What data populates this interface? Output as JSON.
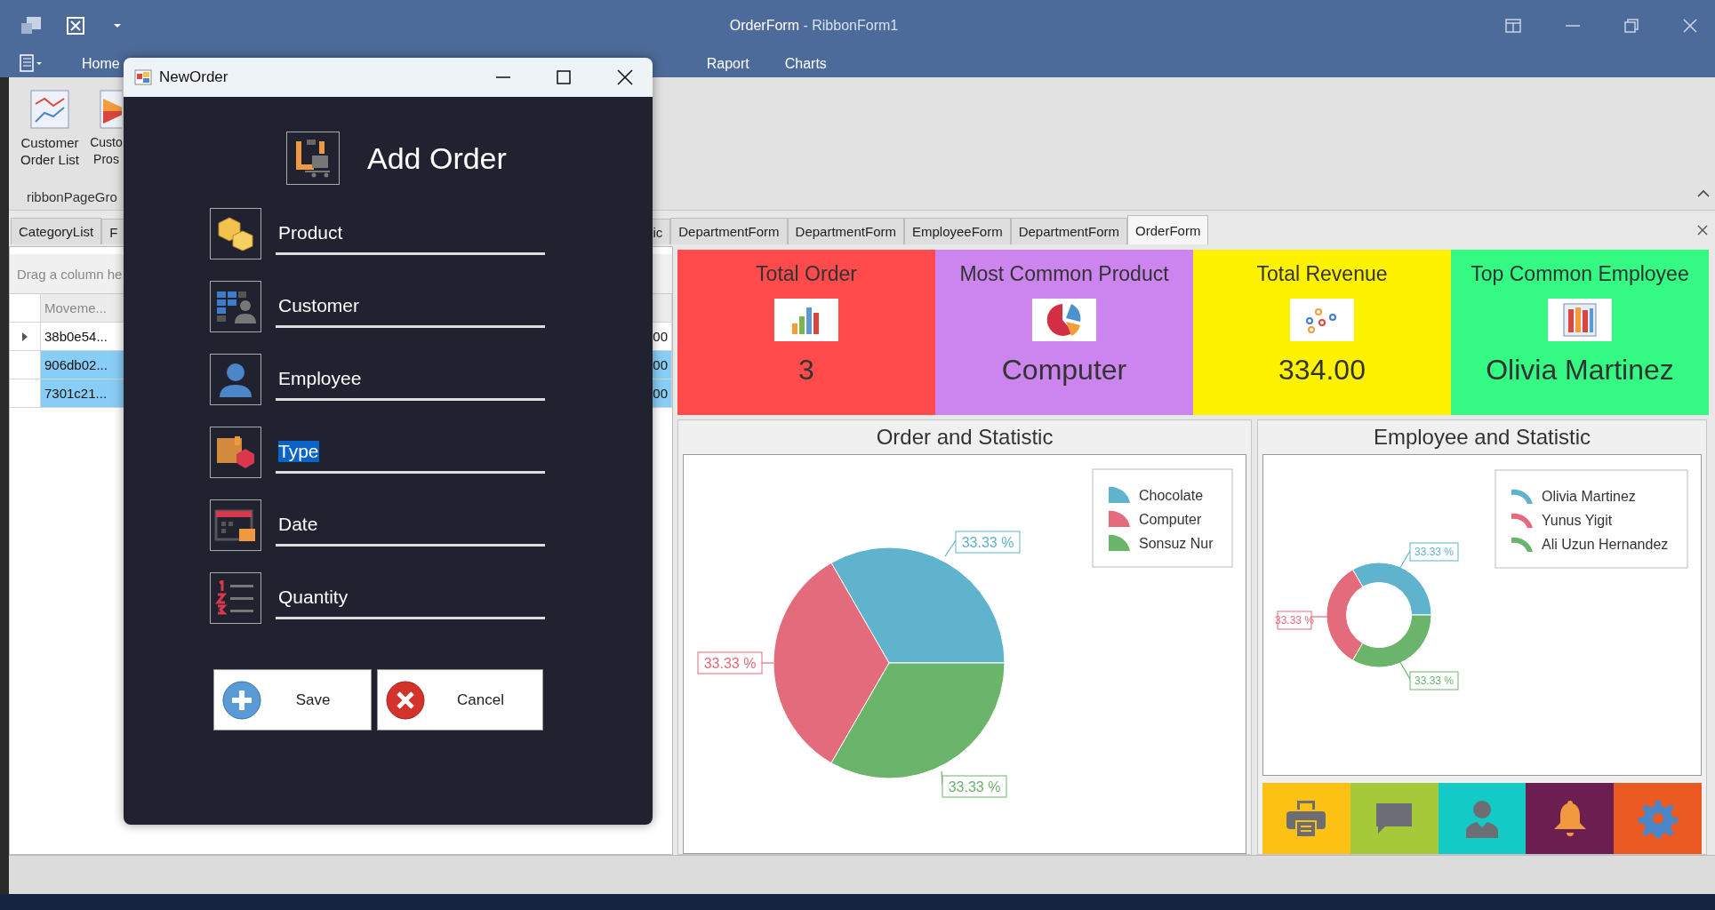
{
  "window": {
    "title": "OrderForm",
    "subtitle": " - RibbonForm1"
  },
  "ribbon": {
    "tabs": [
      {
        "label": "Home",
        "selected": false
      },
      {
        "label": "Raport",
        "selected": false
      },
      {
        "label": "Charts",
        "selected": false
      }
    ],
    "buttons": [
      {
        "label": "Customer Order List"
      },
      {
        "label": "Custo Pros"
      }
    ],
    "group_label": "ribbonPageGro"
  },
  "doc_tabs_left": [
    {
      "label": "CategoryList",
      "selected": false
    },
    {
      "label": "F",
      "selected": false
    }
  ],
  "doc_tabs_right": [
    {
      "label": "ic",
      "selected": false
    },
    {
      "label": "DepartmentForm",
      "selected": false
    },
    {
      "label": "DepartmentForm",
      "selected": false
    },
    {
      "label": "EmployeeForm",
      "selected": false
    },
    {
      "label": "DepartmentForm",
      "selected": false
    },
    {
      "label": "OrderForm",
      "selected": true
    }
  ],
  "grid": {
    "group_hint": "Drag a column he",
    "columns": [
      "Moveme..."
    ],
    "rows": [
      {
        "cells": [
          "38b0e54...",
          "00"
        ],
        "selected": false,
        "focused": true
      },
      {
        "cells": [
          "906db02...",
          "00"
        ],
        "selected": true,
        "focused": false
      },
      {
        "cells": [
          "7301c21...",
          "00"
        ],
        "selected": true,
        "focused": false
      }
    ]
  },
  "cards": [
    {
      "title": "Total Order",
      "value": "3",
      "color": "#ff4b4b"
    },
    {
      "title": "Most Common Product",
      "value": "Computer",
      "color": "#cc84ee"
    },
    {
      "title": "Total Revenue",
      "value": "334.00",
      "color": "#fff200"
    },
    {
      "title": "Top Common Employee",
      "value": "Olivia Martinez",
      "color": "#34f982"
    }
  ],
  "order_chart": {
    "title": "Order and Statistic",
    "chart_data": {
      "type": "pie",
      "legend": "upper right",
      "categories": [
        "Chocolate",
        "Computer",
        "Sonsuz Nur"
      ],
      "values": [
        33.33,
        33.33,
        33.33
      ],
      "data_labels": true,
      "value_labels": [
        "33.33 %",
        "33.33 %",
        "33.33 %"
      ],
      "colors": [
        "#5fb3cd",
        "#e46b7b",
        "#6ab46b"
      ]
    }
  },
  "employee_chart": {
    "title": "Employee and Statistic",
    "chart_data": {
      "type": "donut",
      "legend": "upper right",
      "categories": [
        "Olivia Martinez",
        "Yunus Yigit",
        "Ali Uzun Hernandez"
      ],
      "values": [
        33.33,
        33.33,
        33.33
      ],
      "data_labels": true,
      "value_labels": [
        "33.33 %",
        "33.33 %",
        "33.33 %"
      ],
      "colors": [
        "#5fb3cd",
        "#e46b7b",
        "#6ab46b"
      ]
    }
  },
  "tiles": [
    {
      "color": "#fdc114"
    },
    {
      "color": "#a5c939"
    },
    {
      "color": "#13cac6"
    },
    {
      "color": "#6b1e4f"
    },
    {
      "color": "#ec5a23"
    }
  ],
  "dialog": {
    "title": "NewOrder",
    "heading": "Add Order",
    "fields": [
      {
        "value": "Product",
        "text_selected": false
      },
      {
        "value": "Customer",
        "text_selected": false
      },
      {
        "value": "Employee",
        "text_selected": false
      },
      {
        "value": "Type",
        "text_selected": true
      },
      {
        "value": "Date",
        "text_selected": false
      },
      {
        "value": "Quantity",
        "text_selected": false
      }
    ],
    "buttons": [
      {
        "kind": "save",
        "label": "Save"
      },
      {
        "kind": "cancel",
        "label": "Cancel"
      }
    ]
  }
}
